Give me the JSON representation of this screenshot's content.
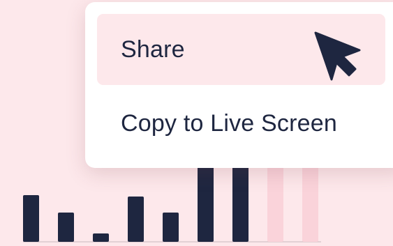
{
  "menu": {
    "items": [
      {
        "label": "Share",
        "highlighted": true
      },
      {
        "label": "Copy to Live Screen",
        "highlighted": false
      }
    ]
  },
  "background_chart": {
    "bars": [
      {
        "level": 0.56,
        "style": "dark"
      },
      {
        "level": 0.35,
        "style": "dark"
      },
      {
        "level": 0.1,
        "style": "dark"
      },
      {
        "level": 0.54,
        "style": "dark"
      },
      {
        "level": 0.35,
        "style": "dark"
      },
      {
        "level": 1.0,
        "style": "dark"
      },
      {
        "level": 1.0,
        "style": "dark"
      },
      {
        "level": 1.0,
        "style": "light"
      },
      {
        "level": 1.0,
        "style": "light"
      }
    ]
  },
  "colors": {
    "background": "#fde8eb",
    "bar_dark": "#1e2640",
    "bar_light": "#fad3da",
    "menu_bg": "#ffffff",
    "highlight": "#fde8eb",
    "text": "#1e2640"
  },
  "icons": {
    "cursor": "arrow-cursor-icon"
  }
}
